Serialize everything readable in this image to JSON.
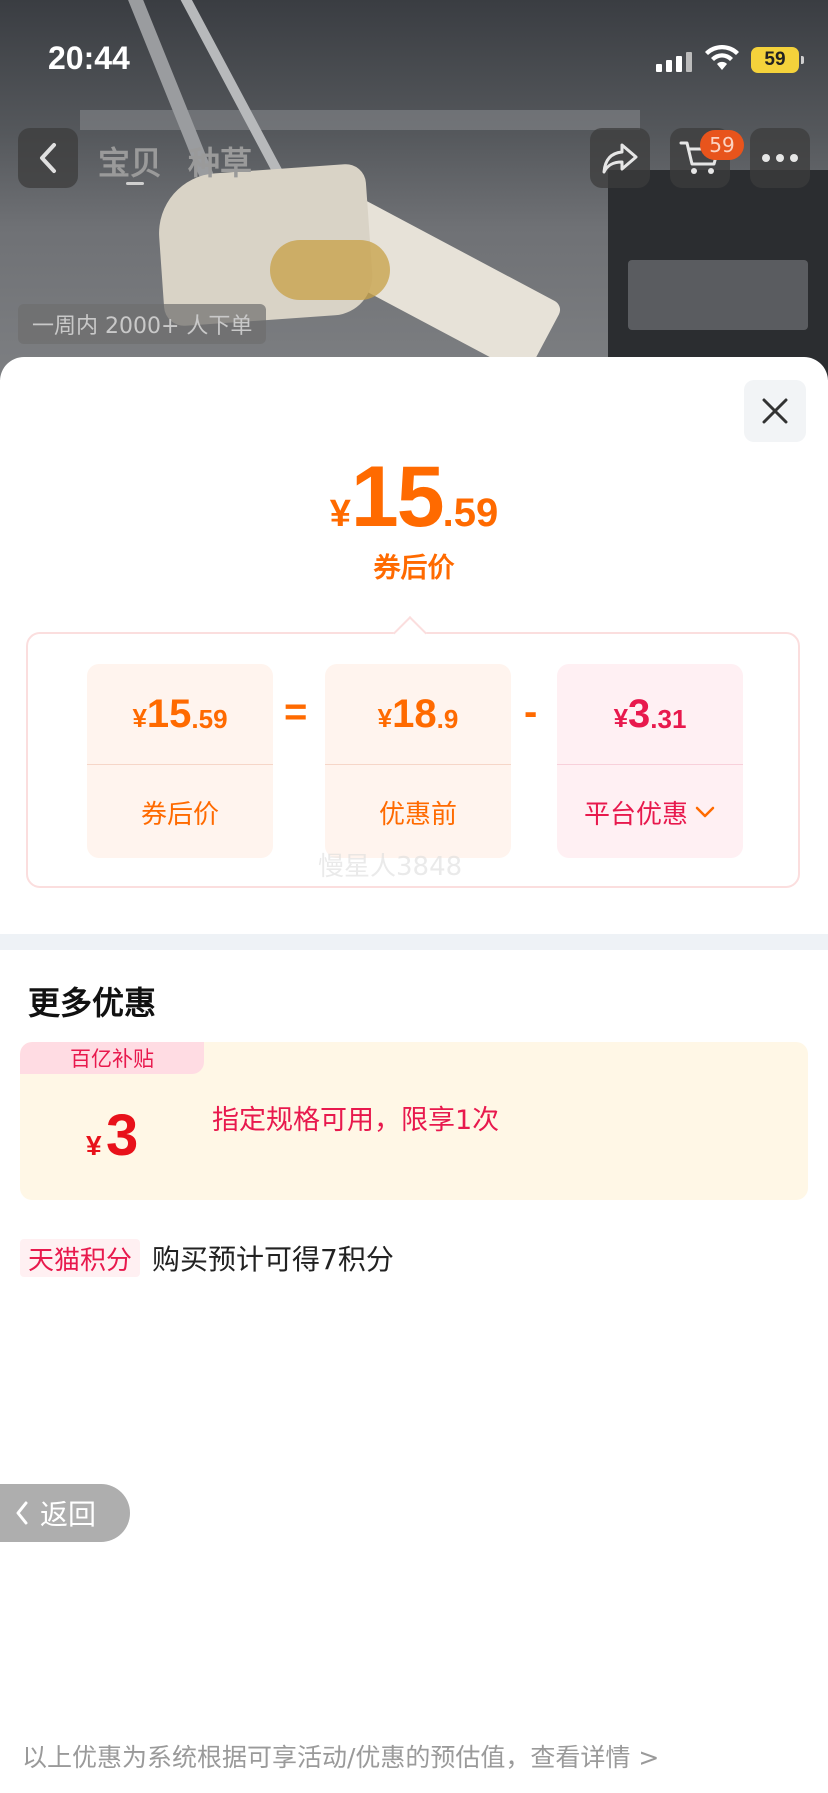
{
  "status_bar": {
    "time": "20:44",
    "battery": "59"
  },
  "nav": {
    "tabs": [
      {
        "label": "宝贝"
      },
      {
        "label": "种草"
      }
    ],
    "cart_count": "59",
    "orders_chip": "一周内 2000+ 人下单"
  },
  "price": {
    "currency": "¥",
    "integer": "15",
    "decimal": ".59",
    "label": "券后价"
  },
  "breakdown": {
    "after_coupon": {
      "currency": "¥",
      "integer": "15",
      "decimal": ".59",
      "label": "券后价"
    },
    "equals": "=",
    "before_discount": {
      "currency": "¥",
      "integer": "18",
      "decimal": ".9",
      "label": "优惠前"
    },
    "minus": "-",
    "platform_discount": {
      "currency": "¥",
      "integer": "3",
      "decimal": ".31",
      "label": "平台优惠"
    },
    "watermark": "慢星人3848"
  },
  "more_offers": {
    "title": "更多优惠",
    "coupon": {
      "tag": "百亿补贴",
      "currency": "¥",
      "amount": "3",
      "description": "指定规格可用，限享1次"
    },
    "points": {
      "tag": "天猫积分",
      "text": "购买预计可得7积分"
    }
  },
  "back_button": {
    "label": "返回"
  },
  "footer": {
    "note": "以上优惠为系统根据可享活动/优惠的预估值，查看详情 >"
  },
  "colors": {
    "accent_orange": "#ff6a00",
    "accent_red": "#e8194d",
    "coupon_bg": "#fff7e6"
  }
}
